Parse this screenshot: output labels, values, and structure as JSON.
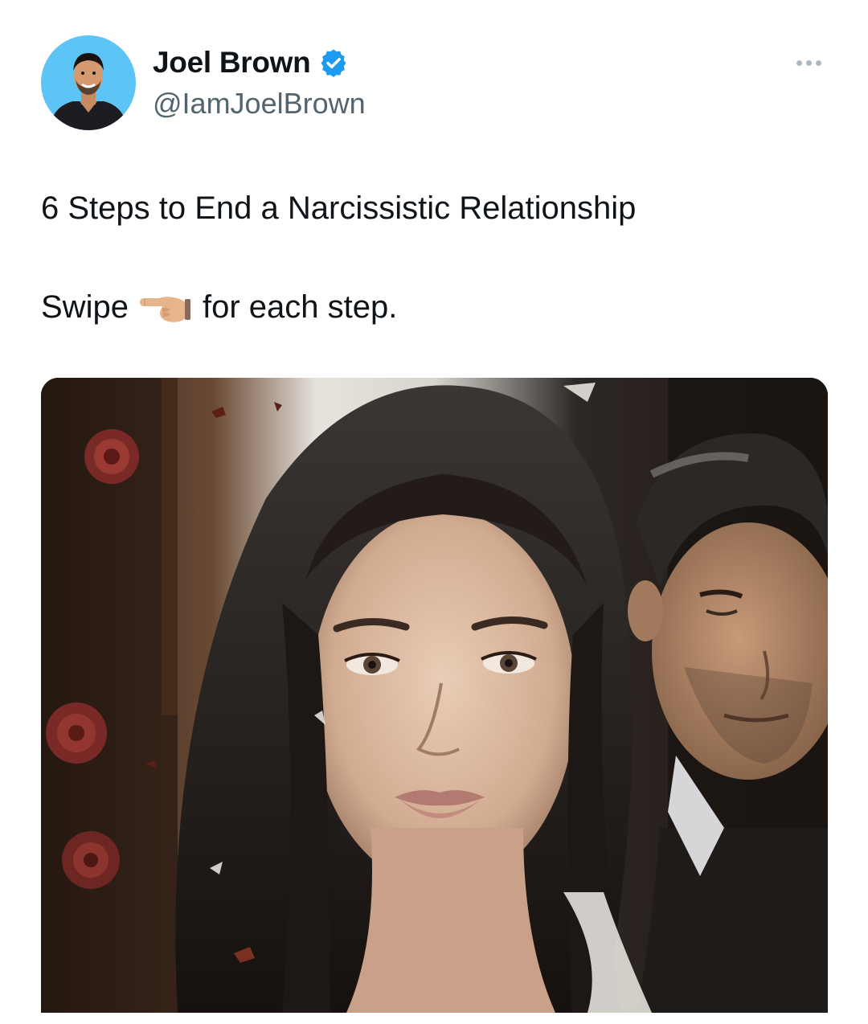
{
  "author": {
    "display_name": "Joel Brown",
    "handle": "@IamJoelBrown",
    "verified_icon": "verified-badge-icon",
    "verified_color": "#1d9bf0",
    "avatar_bg_color": "#5cc5f5"
  },
  "menu": {
    "icon": "more-options-icon"
  },
  "tweet": {
    "title": "6 Steps to End a Narcissistic Relationship",
    "swipe_prefix": "Swipe",
    "swipe_emoji": "pointing-right-hand-icon",
    "swipe_suffix": "for each step."
  },
  "media": {
    "description_icon": "attached-image"
  }
}
